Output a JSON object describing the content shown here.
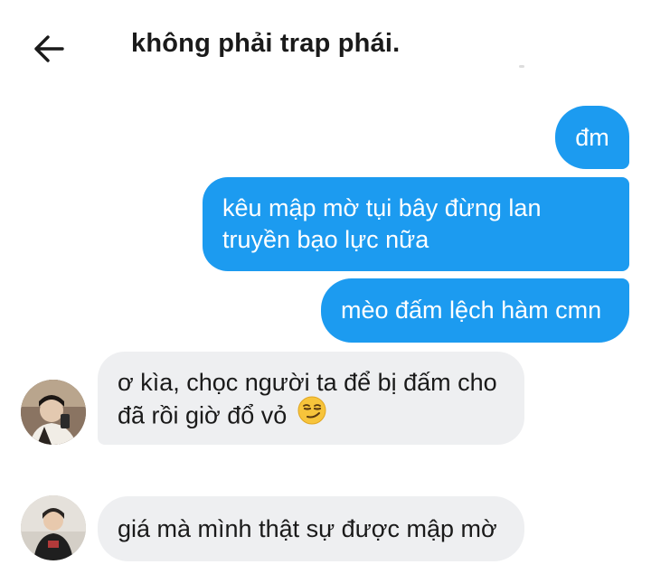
{
  "header": {
    "back_icon": "arrow-left-icon",
    "title": "không phải trap phái."
  },
  "messages": [
    {
      "direction": "sent",
      "text": "đm"
    },
    {
      "direction": "sent",
      "text_line1": "kêu mập mờ tụi bây đừng lan",
      "text_line2": "truyền bạo lực nữa"
    },
    {
      "direction": "sent",
      "text": "mèo đấm lệch hàm cmn"
    },
    {
      "direction": "received",
      "text_line1": "ơ kìa, chọc người ta để bị đấm cho",
      "text_line2": "đã rồi giờ đổ vỏ",
      "emoji": "smirking-face-emoji"
    },
    {
      "direction": "received",
      "text": "giá mà mình thật sự được mập mờ"
    }
  ],
  "colors": {
    "sent_bubble": "#1c9bf0",
    "received_bubble": "#eeeff1",
    "sent_text": "#ffffff",
    "received_text": "#1a1a1a"
  }
}
